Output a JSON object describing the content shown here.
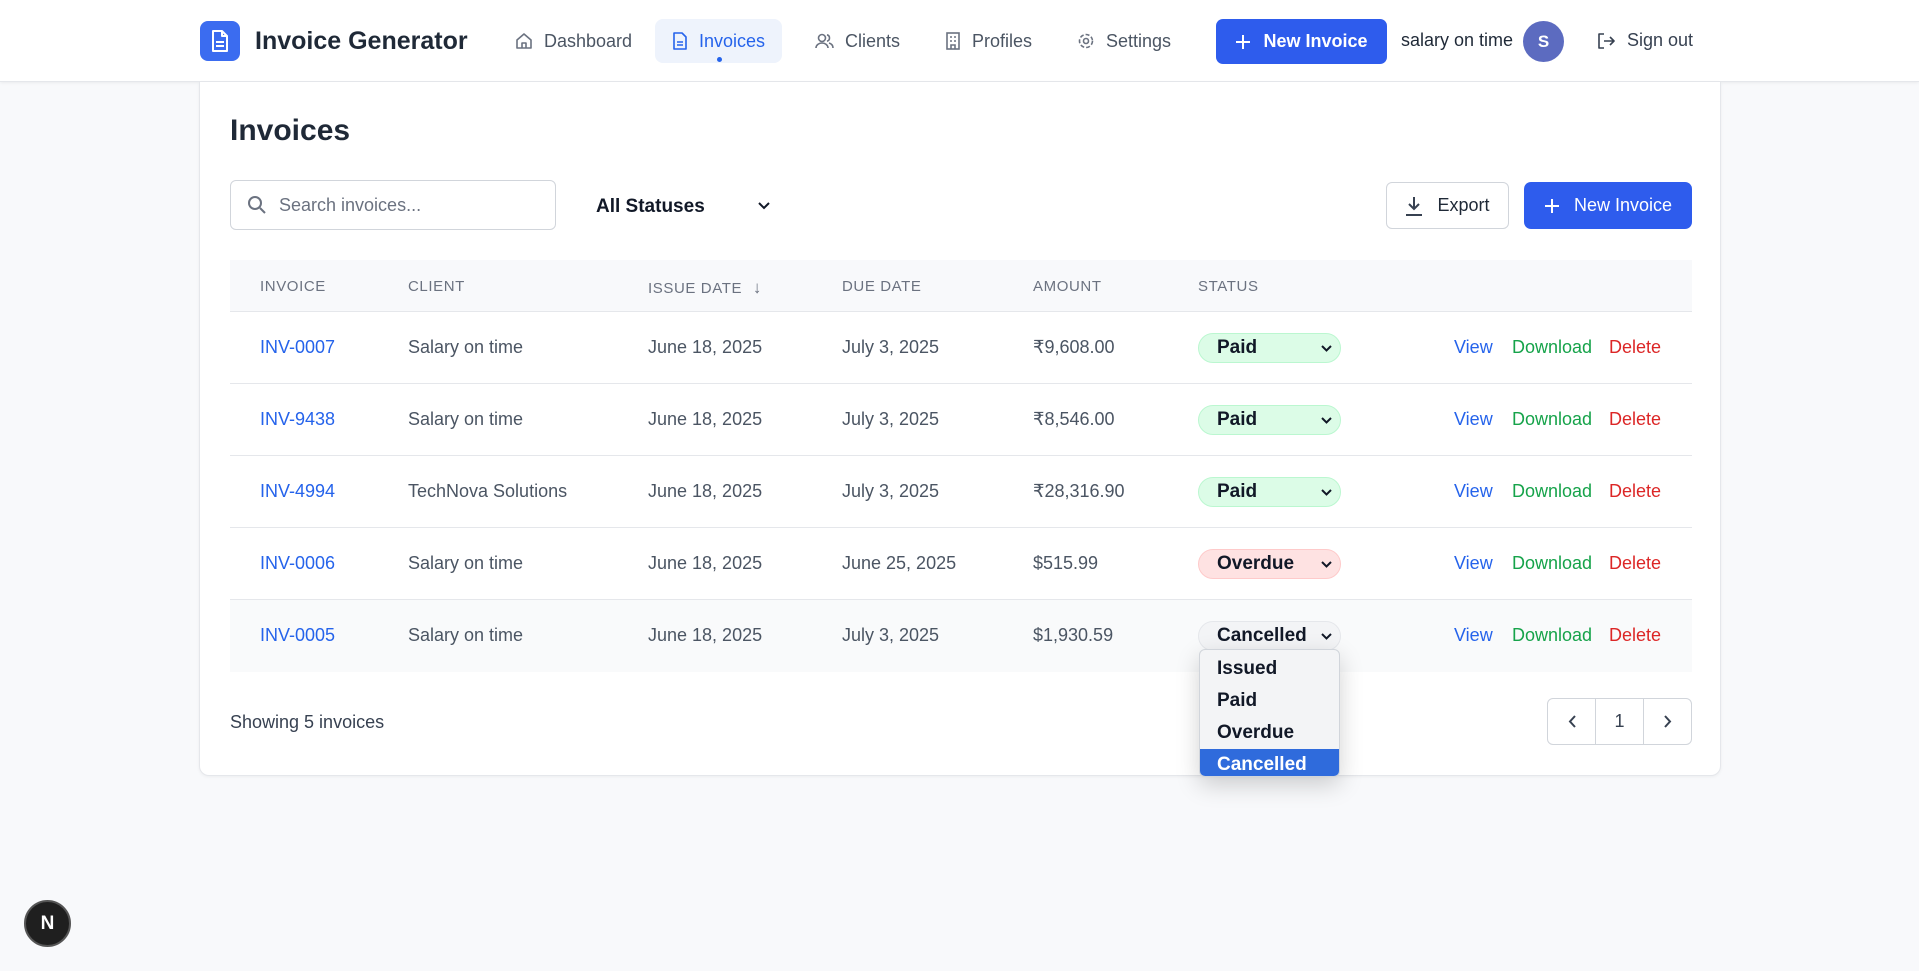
{
  "brand": {
    "title": "Invoice Generator",
    "logo_icon": "document-icon",
    "color": "#3b6cf0"
  },
  "nav": {
    "items": [
      {
        "label": "Dashboard",
        "icon": "home-icon"
      },
      {
        "label": "Invoices",
        "icon": "document-icon",
        "active": true
      },
      {
        "label": "Clients",
        "icon": "users-icon"
      },
      {
        "label": "Profiles",
        "icon": "building-icon"
      },
      {
        "label": "Settings",
        "icon": "gear-icon"
      }
    ],
    "new_invoice_label": "New Invoice",
    "user_name": "salary on time",
    "avatar_initial": "S",
    "sign_out_label": "Sign out"
  },
  "page": {
    "title": "Invoices",
    "search_placeholder": "Search invoices...",
    "status_filter": "All Statuses",
    "export_label": "Export",
    "new_invoice_label": "New Invoice"
  },
  "table": {
    "headers": [
      "INVOICE",
      "CLIENT",
      "ISSUE DATE",
      "DUE DATE",
      "AMOUNT",
      "STATUS"
    ],
    "sort_indicator": "↓",
    "rows": [
      {
        "invoice": "INV-0007",
        "client": "Salary on time",
        "issue": "June 18, 2025",
        "due": "July 3, 2025",
        "amount": "₹9,608.00",
        "status": "Paid"
      },
      {
        "invoice": "INV-9438",
        "client": "Salary on time",
        "issue": "June 18, 2025",
        "due": "July 3, 2025",
        "amount": "₹8,546.00",
        "status": "Paid"
      },
      {
        "invoice": "INV-4994",
        "client": "TechNova Solutions",
        "issue": "June 18, 2025",
        "due": "July 3, 2025",
        "amount": "₹28,316.90",
        "status": "Paid"
      },
      {
        "invoice": "INV-0006",
        "client": "Salary on time",
        "issue": "June 18, 2025",
        "due": "June 25, 2025",
        "amount": "$515.99",
        "status": "Overdue"
      },
      {
        "invoice": "INV-0005",
        "client": "Salary on time",
        "issue": "June 18, 2025",
        "due": "July 3, 2025",
        "amount": "$1,930.59",
        "status": "Cancelled"
      }
    ],
    "actions": {
      "view": "View",
      "download": "Download",
      "delete": "Delete"
    }
  },
  "footer": {
    "showing": "Showing 5 invoices",
    "page": "1"
  },
  "status_dropdown": {
    "options": [
      "Issued",
      "Paid",
      "Overdue",
      "Cancelled"
    ],
    "selected": "Cancelled"
  },
  "dev_badge": "N",
  "colors": {
    "primary": "#2e5ced",
    "link": "#2563eb",
    "download": "#16a34a",
    "delete": "#dc2626",
    "paid_bg": "#dcfce7",
    "overdue_bg": "#fee2e2"
  }
}
